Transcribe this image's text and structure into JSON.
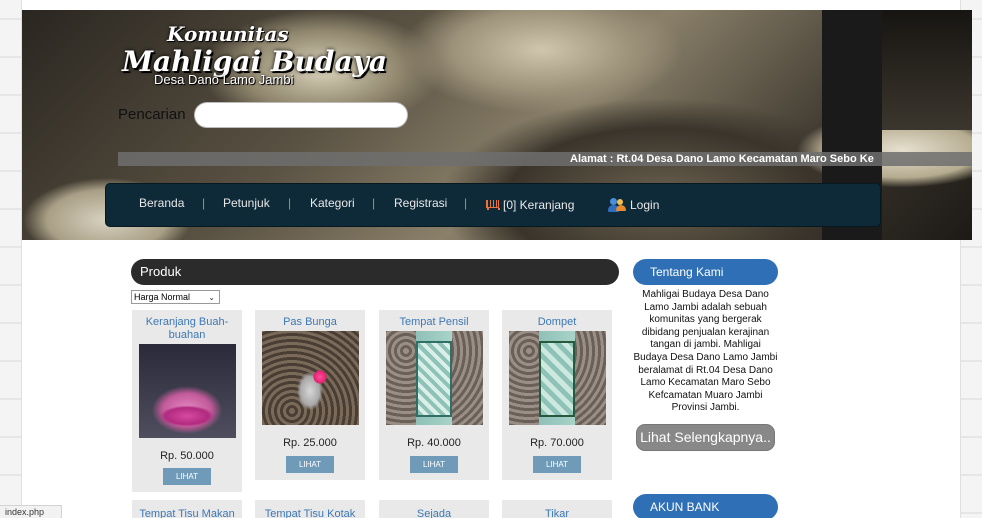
{
  "header": {
    "brand_top": "Komunitas",
    "brand_main": "Mahligai Budaya",
    "brand_sub": "Desa Dano Lamo Jambi",
    "search_label": "Pencarian",
    "search_value": "",
    "marquee": "Alamat : Rt.04 Desa Dano Lamo Kecamatan Maro Sebo Ke"
  },
  "nav": {
    "items": [
      "Beranda",
      "Petunjuk",
      "Kategori",
      "Registrasi"
    ],
    "separator": "|",
    "cart": "[0] Keranjang",
    "login": "Login",
    "cart_icon": "cart-icon",
    "login_icon": "users-icon"
  },
  "products": {
    "header": "Produk",
    "sort_selected": "Harga Normal",
    "view_label": "LIHAT",
    "items": [
      {
        "name": "Keranjang Buah-buahan",
        "price": "Rp. 50.000"
      },
      {
        "name": "Pas Bunga",
        "price": "Rp. 25.000"
      },
      {
        "name": "Tempat Pensil",
        "price": "Rp. 40.000"
      },
      {
        "name": "Dompet",
        "price": "Rp. 70.000"
      },
      {
        "name": "Tempat Tisu Makan",
        "price": ""
      },
      {
        "name": "Tempat Tisu Kotak",
        "price": ""
      },
      {
        "name": "Sejada",
        "price": ""
      },
      {
        "name": "Tikar",
        "price": ""
      }
    ]
  },
  "sidebar": {
    "about_title": "Tentang Kami",
    "about_text": "Mahligai Budaya Desa Dano Lamo Jambi adalah sebuah komunitas yang bergerak dibidang penjualan kerajinan tangan di jambi. Mahligai Budaya Desa Dano Lamo Jambi beralamat di Rt.04 Desa Dano Lamo Kecamatan Maro Sebo Kefcamatan Muaro Jambi Provinsi Jambi.",
    "more_button": "Lihat Selengkapnya..",
    "bank_title": "AKUN BANK"
  },
  "statusbar": {
    "url": "index.php"
  },
  "colors": {
    "nav_bg": "#0e2a38",
    "accent_blue": "#2f6fb5",
    "product_link": "#3d78b5",
    "button_bg": "#6f9bb8"
  }
}
